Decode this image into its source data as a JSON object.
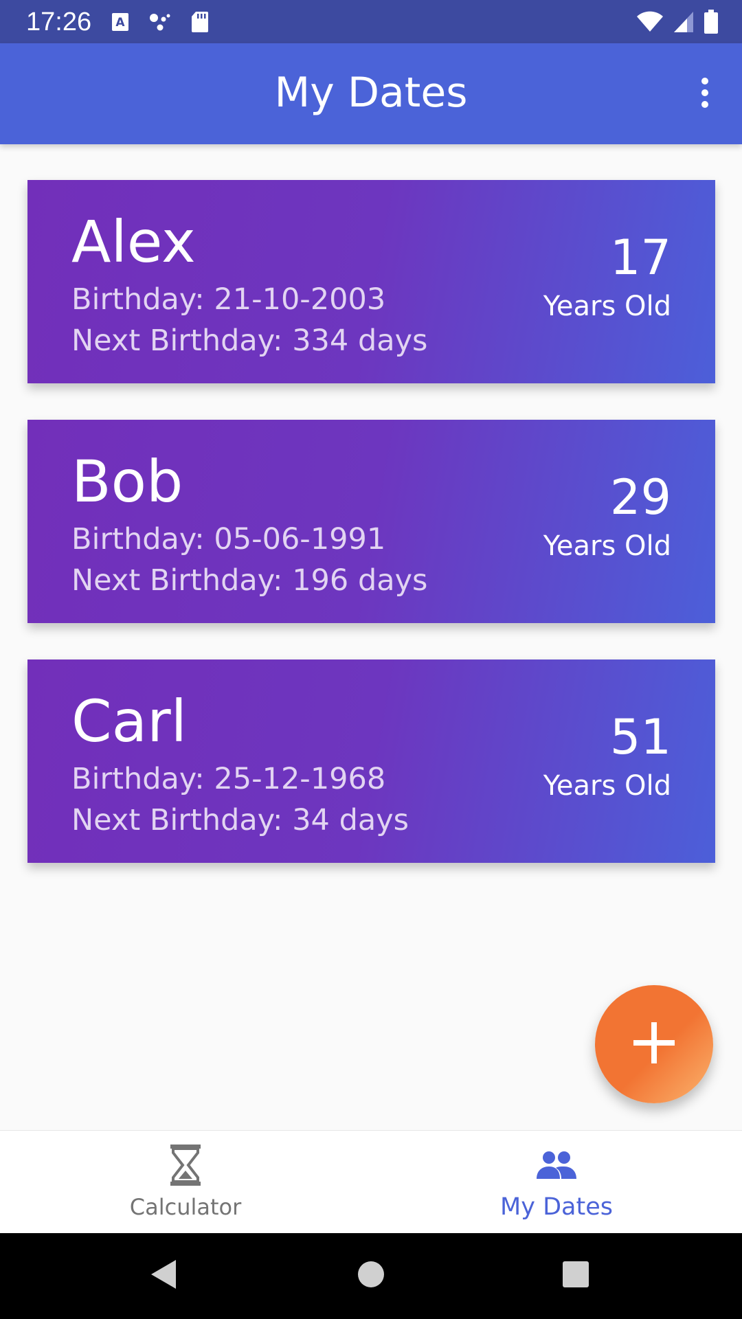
{
  "status_bar": {
    "time": "17:26",
    "left_icons": [
      "keyboard-a-icon",
      "assistant-dots-icon",
      "sd-card-icon"
    ],
    "right_icons": [
      "wifi-icon",
      "signal-icon",
      "battery-icon"
    ]
  },
  "app_bar": {
    "title": "My Dates",
    "menu_icon": "more-vert-icon"
  },
  "cards": [
    {
      "name": "Alex",
      "birthday": "Birthday: 21-10-2003",
      "next_birthday": "Next Birthday: 334 days",
      "age": "17",
      "age_label": "Years Old"
    },
    {
      "name": "Bob",
      "birthday": "Birthday: 05-06-1991",
      "next_birthday": "Next Birthday: 196 days",
      "age": "29",
      "age_label": "Years Old"
    },
    {
      "name": "Carl",
      "birthday": "Birthday: 25-12-1968",
      "next_birthday": "Next Birthday: 34 days",
      "age": "51",
      "age_label": "Years Old"
    }
  ],
  "fab": {
    "icon": "plus-icon",
    "color": "#f27433"
  },
  "bottom_nav": {
    "items": [
      {
        "label": "Calculator",
        "icon": "hourglass-icon",
        "active": false
      },
      {
        "label": "My Dates",
        "icon": "people-icon",
        "active": true
      }
    ]
  },
  "colors": {
    "status_bar": "#3d4aa0",
    "app_bar": "#4b63d8",
    "card_start": "#722fba",
    "card_end": "#4c5fd9",
    "accent": "#f27433",
    "nav_active": "#4b63d8",
    "nav_inactive": "#747474"
  },
  "system_nav": [
    "back-icon",
    "home-icon",
    "recents-icon"
  ]
}
